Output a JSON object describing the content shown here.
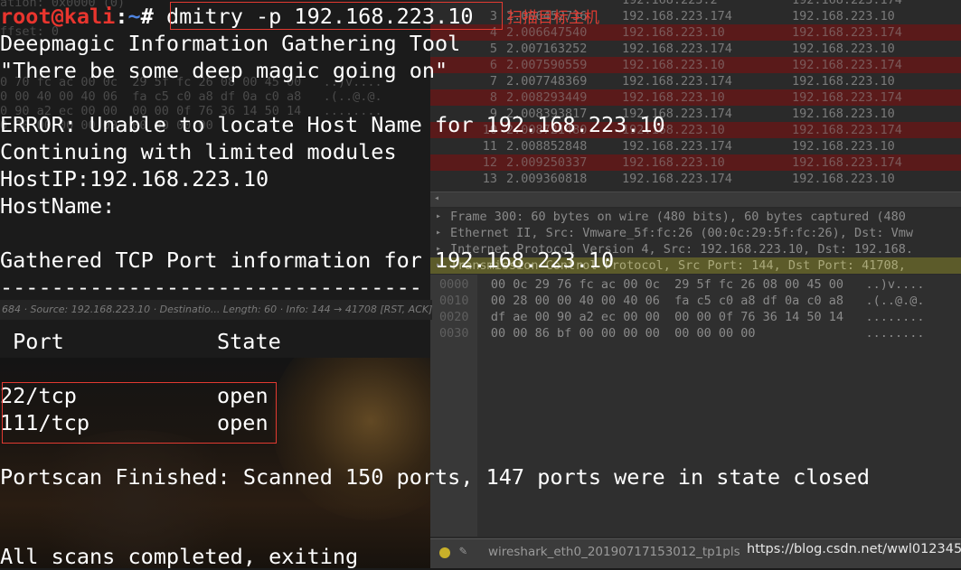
{
  "colors": {
    "prompt_user": "#e8352e",
    "prompt_path": "#4f84e0",
    "annotation_red": "#e23a31",
    "terminal_text": "#ffffff"
  },
  "terminal": {
    "prompt_user": "root@kali",
    "prompt_sep": ":",
    "prompt_path": "~",
    "prompt_hash": "# ",
    "command": "dmitry -p 192.168.223.10",
    "annotation": "扫描目标主机",
    "lines": {
      "l1": "Deepmagic Information Gathering Tool",
      "l2": "\"There be some deep magic going on\"",
      "l3": "ERROR: Unable to locate Host Name for 192.168.223.10",
      "l4": "Continuing with limited modules",
      "l5": "HostIP:192.168.223.10",
      "l6": "HostName:",
      "l7": "Gathered TCP Port information for 192.168.223.10",
      "l8": "---------------------------------",
      "col_port": "Port",
      "col_state": "State",
      "p1_port": "22/tcp",
      "p1_state": "open",
      "p2_port": "111/tcp",
      "p2_state": "open",
      "l9": "Portscan Finished: Scanned 150 ports, 147 ports were in state closed",
      "l10": "All scans completed, exiting"
    }
  },
  "wireshark": {
    "packets": [
      {
        "no": "",
        "time": "",
        "src": "192.168.223.2",
        "dst": "192.168.223.174",
        "red": false
      },
      {
        "no": "3",
        "time": "2.006452736",
        "src": "192.168.223.174",
        "dst": "192.168.223.10",
        "red": false
      },
      {
        "no": "4",
        "time": "2.006647540",
        "src": "192.168.223.10",
        "dst": "192.168.223.174",
        "red": true
      },
      {
        "no": "5",
        "time": "2.007163252",
        "src": "192.168.223.174",
        "dst": "192.168.223.10",
        "red": false
      },
      {
        "no": "6",
        "time": "2.007590559",
        "src": "192.168.223.10",
        "dst": "192.168.223.174",
        "red": true
      },
      {
        "no": "7",
        "time": "2.007748369",
        "src": "192.168.223.174",
        "dst": "192.168.223.10",
        "red": false
      },
      {
        "no": "8",
        "time": "2.008293449",
        "src": "192.168.223.10",
        "dst": "192.168.223.174",
        "red": true
      },
      {
        "no": "9",
        "time": "2.008393817",
        "src": "192.168.223.174",
        "dst": "192.168.223.10",
        "red": false
      },
      {
        "no": "10",
        "time": "2.008721480",
        "src": "192.168.223.10",
        "dst": "192.168.223.174",
        "red": true
      },
      {
        "no": "11",
        "time": "2.008852848",
        "src": "192.168.223.174",
        "dst": "192.168.223.10",
        "red": false
      },
      {
        "no": "12",
        "time": "2.009250337",
        "src": "192.168.223.10",
        "dst": "192.168.223.174",
        "red": true
      },
      {
        "no": "13",
        "time": "2.009360818",
        "src": "192.168.223.174",
        "dst": "192.168.223.10",
        "red": false
      }
    ],
    "details": [
      "Frame 300: 60 bytes on wire (480 bits), 60 bytes captured (480",
      "Ethernet II, Src: Vmware_5f:fc:26 (00:0c:29:5f:fc:26), Dst: Vmw",
      "Internet Protocol Version 4, Src: 192.168.223.10, Dst: 192.168.",
      "Transmission Control Protocol, Src Port: 144, Dst Port: 41708,"
    ],
    "hex": [
      {
        "off": "0000",
        "bytes": "00 0c 29 76 fc ac 00 0c  29 5f fc 26 08 00 45 00",
        "ascii": "..)v...."
      },
      {
        "off": "0010",
        "bytes": "00 28 00 00 40 00 40 06  fa c5 c0 a8 df 0a c0 a8",
        "ascii": ".(..@.@."
      },
      {
        "off": "0020",
        "bytes": "df ae 00 90 a2 ec 00 00  00 00 0f 76 36 14 50 14",
        "ascii": "........"
      },
      {
        "off": "0030",
        "bytes": "00 00 86 bf 00 00 00 00  00 00 00 00",
        "ascii": "........"
      }
    ],
    "infobar": "684 · Source: 192.168.223.10 · Destinatio... Length: 60 · Info: 144 → 41708 [RST, ACK] Seq=1",
    "status_file": "wireshark_eth0_20190717153012_tp1pls"
  },
  "ghost_left": [
    "ation: 0x0000 (0)",
    "ffset: 0",
    "0 70 fc ac 00 0c  29 5f fc 26 08 00 45 00   ..)v....",
    "0 00 40 00 40 06  fa c5 c0 a8 df 0a c0 a8   .(..@.@.",
    "0 90 a2 ec 00 00  00 00 0f 76 36 14 50 14   ........",
    "0 00 00 00 00 00  00 00 00 00"
  ],
  "watermark": "https://blog.csdn.net/wwl012345"
}
